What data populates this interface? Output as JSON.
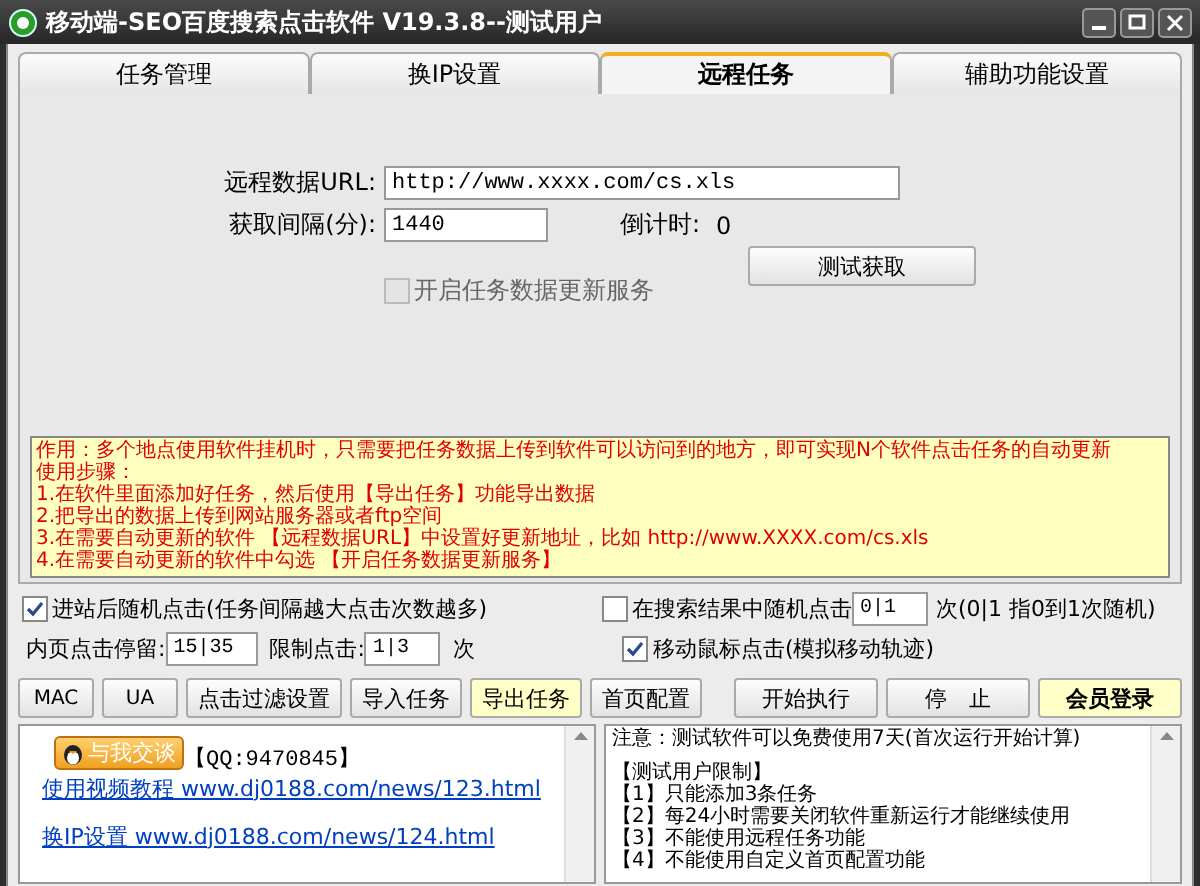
{
  "window": {
    "title": "移动端-SEO百度搜索点击软件 V19.3.8--测试用户"
  },
  "tabs": [
    {
      "label": "任务管理",
      "selected": false
    },
    {
      "label": "换IP设置",
      "selected": false
    },
    {
      "label": "远程任务",
      "selected": true
    },
    {
      "label": "辅助功能设置",
      "selected": false
    }
  ],
  "remote": {
    "url_label": "远程数据URL:",
    "url_value": "http://www.xxxx.com/cs.xls",
    "interval_label": "获取间隔(分):",
    "interval_value": "1440",
    "countdown_label": "倒计时:",
    "countdown_value": "0",
    "service_checkbox": {
      "label": "开启任务数据更新服务",
      "checked": false,
      "disabled": true
    },
    "test_button": "测试获取",
    "notes": [
      "作用：多个地点使用软件挂机时，只需要把任务数据上传到软件可以访问到的地方，即可实现N个软件点击任务的自动更新",
      "使用步骤：",
      "1.在软件里面添加好任务，然后使用【导出任务】功能导出数据",
      "2.把导出的数据上传到网站服务器或者ftp空间",
      "3.在需要自动更新的软件 【远程数据URL】中设置好更新地址，比如 http://www.XXXX.com/cs.xls",
      "4.在需要自动更新的软件中勾选 【开启任务数据更新服务】"
    ]
  },
  "options": {
    "random_click": {
      "label": "进站后随机点击(任务间隔越大点击次数越多)",
      "checked": true
    },
    "search_random": {
      "label": "在搜索结果中随机点击",
      "checked": false,
      "value": "0|1",
      "hint": "次(0|1 指0到1次随机)"
    },
    "stay_label": "内页点击停留:",
    "stay_value": "15|35",
    "limit_label": "限制点击:",
    "limit_value": "1|3",
    "limit_unit": "次",
    "mouse_move": {
      "label": "移动鼠标点击(模拟移动轨迹)",
      "checked": true
    }
  },
  "buttons": [
    {
      "label": "MAC",
      "highlighted": false
    },
    {
      "label": "UA",
      "highlighted": false
    },
    {
      "label": "点击过滤设置",
      "highlighted": false
    },
    {
      "label": "导入任务",
      "highlighted": false
    },
    {
      "label": "导出任务",
      "highlighted": true
    },
    {
      "label": "首页配置",
      "highlighted": false
    },
    {
      "label": "开始执行",
      "highlighted": false
    },
    {
      "label": "停　止",
      "highlighted": false
    },
    {
      "label": "会员登录",
      "highlighted": true
    }
  ],
  "links_panel": {
    "chat_button": "与我交谈",
    "qq": "【QQ:9470845】",
    "links": [
      "使用视频教程 www.dj0188.com/news/123.html",
      "换IP设置 www.dj0188.com/news/124.html"
    ]
  },
  "notice_panel": {
    "lines": [
      "注意：测试软件可以免费使用7天(首次运行开始计算)",
      "【测试用户限制】",
      "【1】只能添加3条任务",
      "【2】每24小时需要关闭软件重新运行才能继续使用",
      "【3】不能使用远程任务功能",
      "【4】不能使用自定义首页配置功能"
    ]
  }
}
